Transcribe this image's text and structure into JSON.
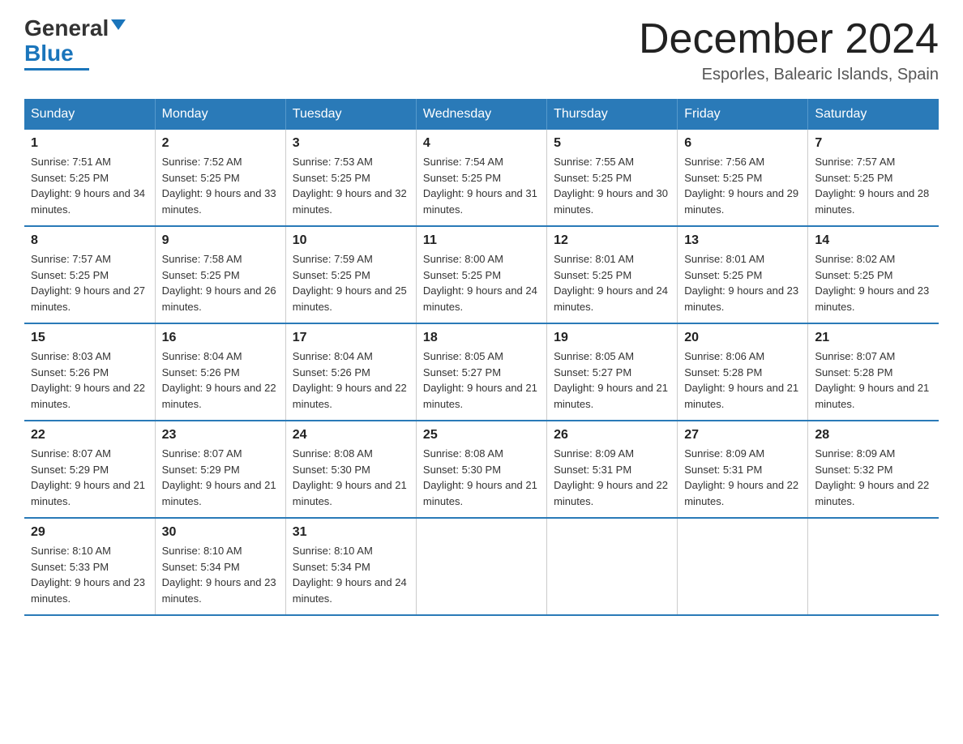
{
  "header": {
    "logo": {
      "general": "General",
      "blue": "Blue"
    },
    "title": "December 2024",
    "subtitle": "Esporles, Balearic Islands, Spain"
  },
  "weekdays": [
    "Sunday",
    "Monday",
    "Tuesday",
    "Wednesday",
    "Thursday",
    "Friday",
    "Saturday"
  ],
  "weeks": [
    [
      {
        "day": "1",
        "sunrise": "7:51 AM",
        "sunset": "5:25 PM",
        "daylight": "9 hours and 34 minutes."
      },
      {
        "day": "2",
        "sunrise": "7:52 AM",
        "sunset": "5:25 PM",
        "daylight": "9 hours and 33 minutes."
      },
      {
        "day": "3",
        "sunrise": "7:53 AM",
        "sunset": "5:25 PM",
        "daylight": "9 hours and 32 minutes."
      },
      {
        "day": "4",
        "sunrise": "7:54 AM",
        "sunset": "5:25 PM",
        "daylight": "9 hours and 31 minutes."
      },
      {
        "day": "5",
        "sunrise": "7:55 AM",
        "sunset": "5:25 PM",
        "daylight": "9 hours and 30 minutes."
      },
      {
        "day": "6",
        "sunrise": "7:56 AM",
        "sunset": "5:25 PM",
        "daylight": "9 hours and 29 minutes."
      },
      {
        "day": "7",
        "sunrise": "7:57 AM",
        "sunset": "5:25 PM",
        "daylight": "9 hours and 28 minutes."
      }
    ],
    [
      {
        "day": "8",
        "sunrise": "7:57 AM",
        "sunset": "5:25 PM",
        "daylight": "9 hours and 27 minutes."
      },
      {
        "day": "9",
        "sunrise": "7:58 AM",
        "sunset": "5:25 PM",
        "daylight": "9 hours and 26 minutes."
      },
      {
        "day": "10",
        "sunrise": "7:59 AM",
        "sunset": "5:25 PM",
        "daylight": "9 hours and 25 minutes."
      },
      {
        "day": "11",
        "sunrise": "8:00 AM",
        "sunset": "5:25 PM",
        "daylight": "9 hours and 24 minutes."
      },
      {
        "day": "12",
        "sunrise": "8:01 AM",
        "sunset": "5:25 PM",
        "daylight": "9 hours and 24 minutes."
      },
      {
        "day": "13",
        "sunrise": "8:01 AM",
        "sunset": "5:25 PM",
        "daylight": "9 hours and 23 minutes."
      },
      {
        "day": "14",
        "sunrise": "8:02 AM",
        "sunset": "5:25 PM",
        "daylight": "9 hours and 23 minutes."
      }
    ],
    [
      {
        "day": "15",
        "sunrise": "8:03 AM",
        "sunset": "5:26 PM",
        "daylight": "9 hours and 22 minutes."
      },
      {
        "day": "16",
        "sunrise": "8:04 AM",
        "sunset": "5:26 PM",
        "daylight": "9 hours and 22 minutes."
      },
      {
        "day": "17",
        "sunrise": "8:04 AM",
        "sunset": "5:26 PM",
        "daylight": "9 hours and 22 minutes."
      },
      {
        "day": "18",
        "sunrise": "8:05 AM",
        "sunset": "5:27 PM",
        "daylight": "9 hours and 21 minutes."
      },
      {
        "day": "19",
        "sunrise": "8:05 AM",
        "sunset": "5:27 PM",
        "daylight": "9 hours and 21 minutes."
      },
      {
        "day": "20",
        "sunrise": "8:06 AM",
        "sunset": "5:28 PM",
        "daylight": "9 hours and 21 minutes."
      },
      {
        "day": "21",
        "sunrise": "8:07 AM",
        "sunset": "5:28 PM",
        "daylight": "9 hours and 21 minutes."
      }
    ],
    [
      {
        "day": "22",
        "sunrise": "8:07 AM",
        "sunset": "5:29 PM",
        "daylight": "9 hours and 21 minutes."
      },
      {
        "day": "23",
        "sunrise": "8:07 AM",
        "sunset": "5:29 PM",
        "daylight": "9 hours and 21 minutes."
      },
      {
        "day": "24",
        "sunrise": "8:08 AM",
        "sunset": "5:30 PM",
        "daylight": "9 hours and 21 minutes."
      },
      {
        "day": "25",
        "sunrise": "8:08 AM",
        "sunset": "5:30 PM",
        "daylight": "9 hours and 21 minutes."
      },
      {
        "day": "26",
        "sunrise": "8:09 AM",
        "sunset": "5:31 PM",
        "daylight": "9 hours and 22 minutes."
      },
      {
        "day": "27",
        "sunrise": "8:09 AM",
        "sunset": "5:31 PM",
        "daylight": "9 hours and 22 minutes."
      },
      {
        "day": "28",
        "sunrise": "8:09 AM",
        "sunset": "5:32 PM",
        "daylight": "9 hours and 22 minutes."
      }
    ],
    [
      {
        "day": "29",
        "sunrise": "8:10 AM",
        "sunset": "5:33 PM",
        "daylight": "9 hours and 23 minutes."
      },
      {
        "day": "30",
        "sunrise": "8:10 AM",
        "sunset": "5:34 PM",
        "daylight": "9 hours and 23 minutes."
      },
      {
        "day": "31",
        "sunrise": "8:10 AM",
        "sunset": "5:34 PM",
        "daylight": "9 hours and 24 minutes."
      },
      null,
      null,
      null,
      null
    ]
  ]
}
